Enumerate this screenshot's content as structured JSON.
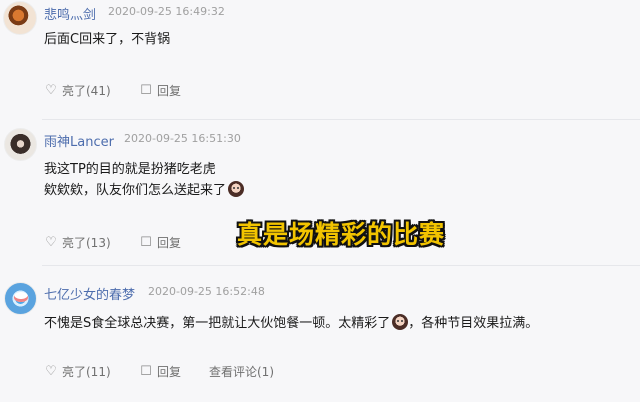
{
  "comments": [
    {
      "user": "悲鸣灬剑",
      "time": "2020-09-25 16:49:32",
      "lines": [
        "后面C回来了，不背锅"
      ],
      "like_label": "亮了(41)",
      "reply_label": "回复"
    },
    {
      "user": "雨神Lancer",
      "time": "2020-09-25 16:51:30",
      "lines": [
        "我这TP的目的就是扮猪吃老虎",
        "欸欸欸，队友你们怎么送起来了"
      ],
      "like_label": "亮了(13)",
      "reply_label": "回复"
    },
    {
      "user": "七亿少女的春梦",
      "time": "2020-09-25 16:52:48",
      "lines": [
        "不愧是S食全球总决赛，第一把就让大伙饱餐一顿。太精彩了",
        "，各种节目效果拉满。"
      ],
      "like_label": "亮了(11)",
      "reply_label": "回复",
      "view_replies_label": "查看评论(1)"
    }
  ],
  "overlay": {
    "text": "真是场精彩的比赛"
  },
  "icons": {
    "like": "like-icon",
    "reply": "reply-icon"
  },
  "colors": {
    "username": "#4d6dad",
    "overlay": "#f2c400"
  }
}
